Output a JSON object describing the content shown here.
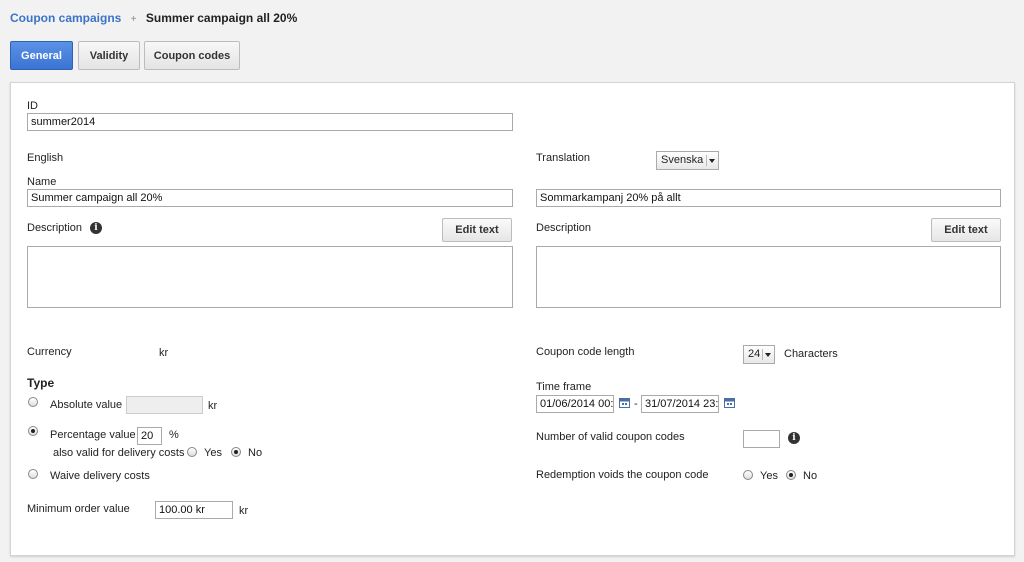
{
  "breadcrumb": {
    "parent": "Coupon campaigns",
    "separator": "+",
    "current": "Summer campaign all 20%"
  },
  "tabs": [
    {
      "label": "General",
      "active": true
    },
    {
      "label": "Validity",
      "active": false
    },
    {
      "label": "Coupon codes",
      "active": false
    }
  ],
  "form": {
    "id_label": "ID",
    "id_value": "summer2014",
    "english_label": "English",
    "name_label": "Name",
    "name_value": "Summer campaign all 20%",
    "description_label": "Description",
    "edit_text_label": "Edit text",
    "translation_label": "Translation",
    "translation_language": "Svenska",
    "translation_name_value": "Sommarkampanj 20% på allt",
    "translation_description_label": "Description",
    "translation_edit_text_label": "Edit text",
    "currency_label": "Currency",
    "currency_value": "kr",
    "type_heading": "Type",
    "absolute_value_label": "Absolute value",
    "absolute_value": "",
    "absolute_unit": "kr",
    "percentage_label": "Percentage value",
    "percentage_value": "20",
    "percentage_unit": "%",
    "also_valid_label": "also valid for delivery costs",
    "yes_label": "Yes",
    "no_label": "No",
    "waive_delivery_label": "Waive delivery costs",
    "min_order_label": "Minimum order value",
    "min_order_value": "100.00 kr",
    "min_order_unit": "kr",
    "code_length_label": "Coupon code length",
    "code_length_value": "24",
    "characters_label": "Characters",
    "time_frame_label": "Time frame",
    "time_from": "01/06/2014 00:0",
    "time_dash": "-",
    "time_to": "31/07/2014 23:5",
    "valid_codes_label": "Number of valid coupon codes",
    "valid_codes_value": "",
    "redemption_label": "Redemption voids the coupon code",
    "redemption_yes": "Yes",
    "redemption_no": "No"
  },
  "colors": {
    "accent": "#3b73d3",
    "link": "#3b73c8"
  }
}
